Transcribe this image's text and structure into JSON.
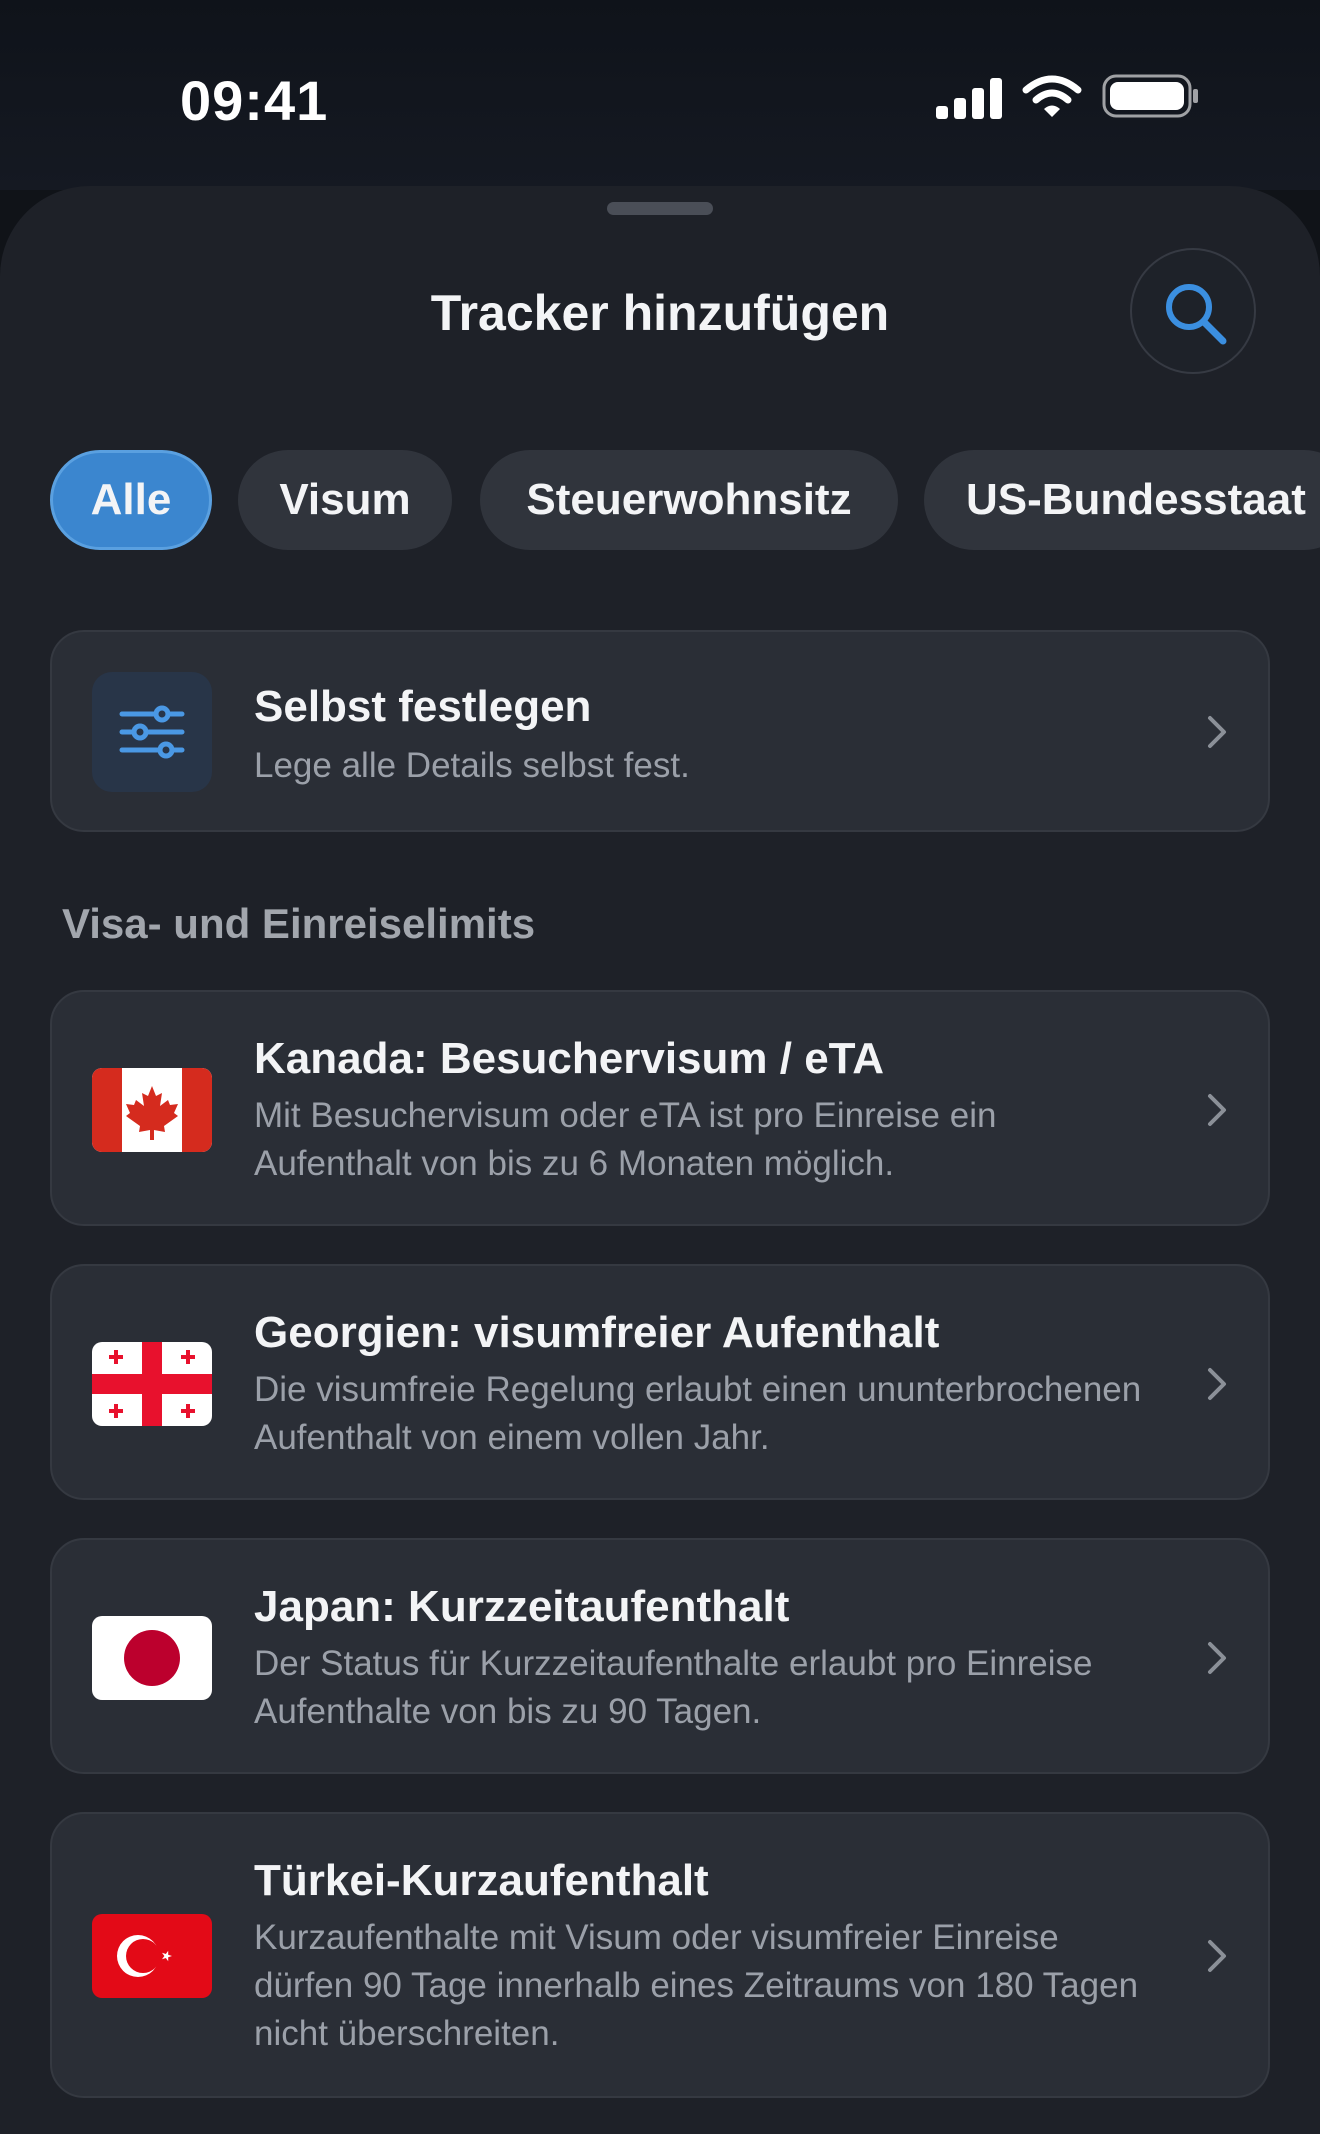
{
  "status_bar": {
    "time": "09:41",
    "icons": [
      "cellular-signal-icon",
      "wifi-icon",
      "battery-icon"
    ]
  },
  "header": {
    "title": "Tracker hinzufügen",
    "search_icon": "search-icon"
  },
  "filters": [
    {
      "label": "Alle",
      "active": true
    },
    {
      "label": "Visum",
      "active": false
    },
    {
      "label": "Steuerwohnsitz",
      "active": false
    },
    {
      "label": "US-Bundesstaat",
      "active": false
    }
  ],
  "custom_tracker": {
    "icon": "sliders-icon",
    "title": "Selbst festlegen",
    "description": "Lege alle Details selbst fest."
  },
  "section": {
    "title": "Visa- und Einreiselimits"
  },
  "trackers": [
    {
      "flag": "canada-flag-icon",
      "title": "Kanada: Besuchervisum / eTA",
      "description": "Mit Besuchervisum oder eTA ist pro Einreise ein Aufenthalt von bis zu 6 Monaten möglich."
    },
    {
      "flag": "georgia-flag-icon",
      "title": "Georgien: visumfreier Aufenthalt",
      "description": "Die visumfreie Regelung erlaubt einen ununterbro­chenen Aufenthalt von einem vollen Jahr."
    },
    {
      "flag": "japan-flag-icon",
      "title": "Japan: Kurzzeitaufenthalt",
      "description": "Der Status für Kurzzeitaufenthalte erlaubt pro Einreise Aufenthalte von bis zu 90 Tagen."
    },
    {
      "flag": "turkey-flag-icon",
      "title": "Türkei-Kurzaufenthalt",
      "description": "Kurzaufenthalte mit Visum oder visumfreier Einreise dürfen 90 Tage innerhalb eines Zeitraums von 180 Tagen nicht überschreiten."
    }
  ],
  "colors": {
    "accent": "#3b86cf",
    "card": "#2a2e36",
    "sheet": "#1e2128"
  }
}
